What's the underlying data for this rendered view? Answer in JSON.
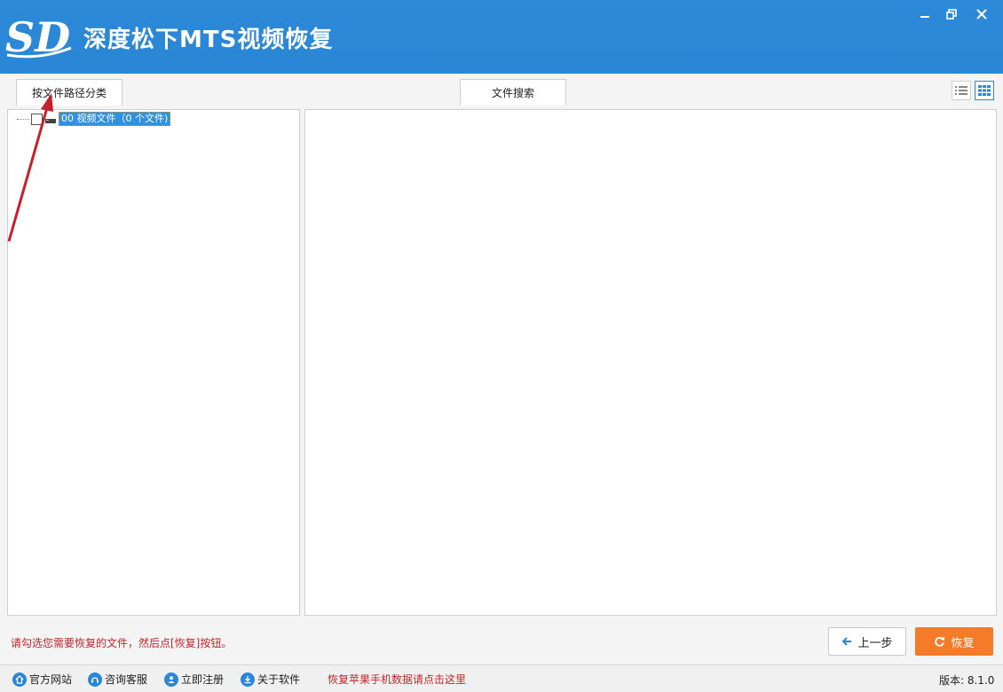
{
  "window": {
    "title": "深度松下MTS视频恢复",
    "logo_text": "SD"
  },
  "tabs": [
    {
      "label": "按文件路径分类"
    },
    {
      "label": "文件搜索"
    }
  ],
  "tree": {
    "items": [
      {
        "label": "00 视频文件（0 个文件)",
        "checked": false
      }
    ]
  },
  "hint_text": "请勾选您需要恢复的文件，然后点[恢复]按钮。",
  "buttons": {
    "prev_label": "上一步",
    "recover_label": "恢复"
  },
  "status_bar": {
    "links": [
      {
        "label": "官方网站",
        "icon": "home-icon"
      },
      {
        "label": "咨询客服",
        "icon": "support-icon"
      },
      {
        "label": "立即注册",
        "icon": "register-icon"
      },
      {
        "label": "关于软件",
        "icon": "info-icon"
      }
    ],
    "promo": "恢复苹果手机数据请点击这里",
    "version": "版本: 8.1.0"
  },
  "colors": {
    "accent": "#2a86d6",
    "recover_button": "#f47b28",
    "hint_text": "#c0262a"
  }
}
